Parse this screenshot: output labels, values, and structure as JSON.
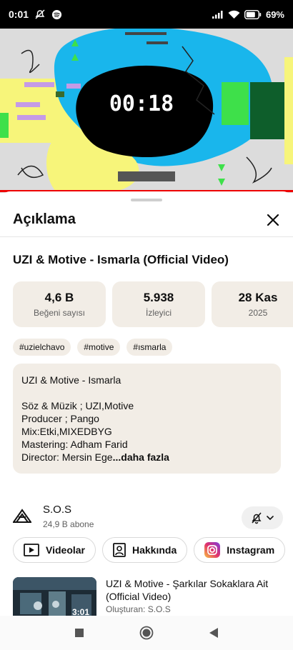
{
  "status_bar": {
    "time": "0:01",
    "battery": "69%",
    "icons": [
      "mute-icon",
      "spotify-icon",
      "signal-icon",
      "wifi-icon",
      "battery-icon"
    ]
  },
  "player": {
    "timer": "00:18",
    "progress": 0.0,
    "accent_color": "#ee0000"
  },
  "sheet": {
    "title": "Açıklama",
    "close_icon": "close-icon"
  },
  "video": {
    "title": "UZI & Motive - Ismarla (Official Video)",
    "stats": [
      {
        "value": "4,6 B",
        "label": "Beğeni sayısı"
      },
      {
        "value": "5.938",
        "label": "İzleyici"
      },
      {
        "value": "28 Kas",
        "label": "2025"
      }
    ],
    "tags": [
      "#uzielchavo",
      "#motive",
      "#ısmarla"
    ],
    "description": [
      "UZI & Motive - Ismarla",
      "",
      "Söz & Müzik ; UZI,Motive",
      "Producer ; Pango",
      "Mix:Etki,MIXEDBYG",
      "Mastering: Adham Farid",
      "Director: Mersin Ege"
    ],
    "more_label": "...daha fazla"
  },
  "channel": {
    "name": "S.O.S",
    "subscribers": "24,9 B abone",
    "buttons": [
      {
        "label": "Videolar",
        "icon": "video-icon"
      },
      {
        "label": "Hakkında",
        "icon": "person-icon"
      },
      {
        "label": "Instagram",
        "icon": "instagram-icon"
      }
    ]
  },
  "related": {
    "title": "UZI & Motive - Şarkılar Sokaklara Ait (Official Video)",
    "byline": "Oluşturan: S.O.S",
    "duration": "3:01"
  },
  "colors": {
    "card_bg": "#f2ede6",
    "sky_blue": "#19b6ec",
    "yellow": "#f7f57a",
    "green": "#3ee04a",
    "purple": "#c59be6"
  }
}
